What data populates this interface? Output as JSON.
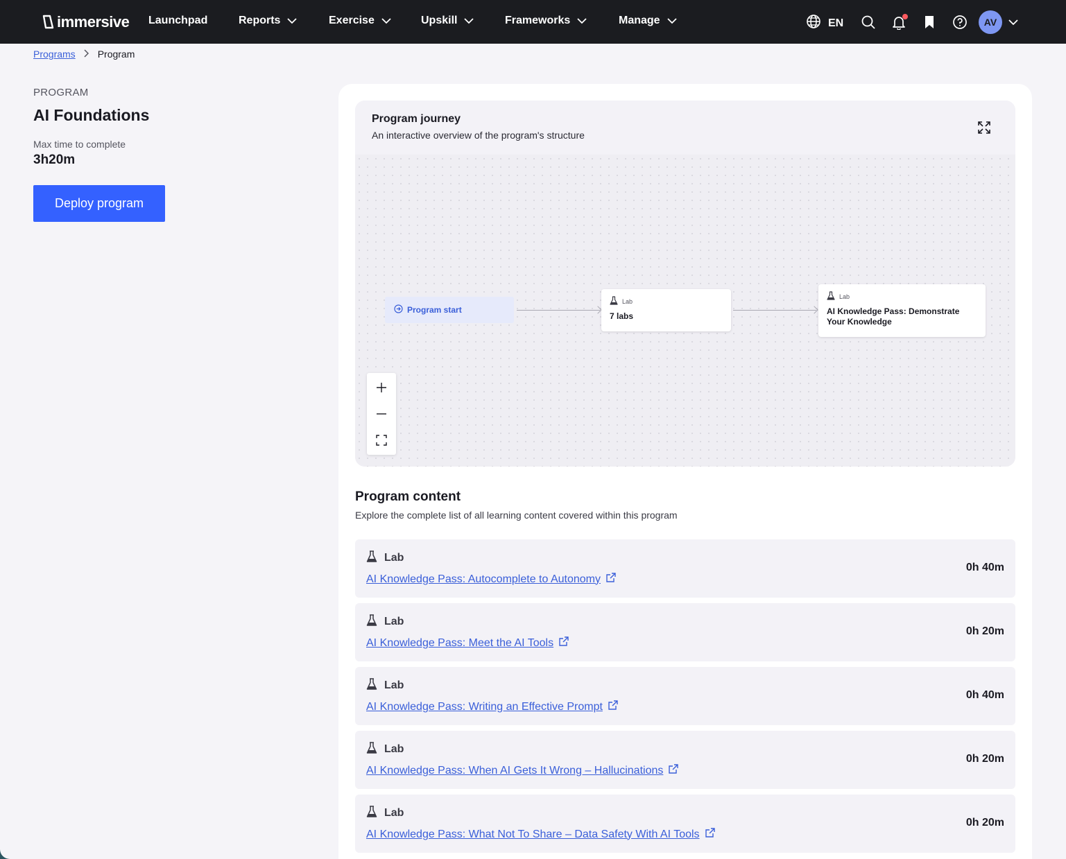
{
  "nav": {
    "brand": "immersive",
    "items": [
      {
        "label": "Launchpad",
        "dropdown": false
      },
      {
        "label": "Reports",
        "dropdown": true
      },
      {
        "label": "Exercise",
        "dropdown": true
      },
      {
        "label": "Upskill",
        "dropdown": true
      },
      {
        "label": "Frameworks",
        "dropdown": true
      },
      {
        "label": "Manage",
        "dropdown": true
      }
    ],
    "language": "EN",
    "avatar_initials": "AV",
    "icons": [
      "globe-icon",
      "search-icon",
      "bell-icon",
      "bookmark-icon",
      "help-icon",
      "chevron-down-icon"
    ]
  },
  "breadcrumb": {
    "parent": "Programs",
    "current": "Program"
  },
  "program": {
    "eyebrow": "PROGRAM",
    "title": "AI Foundations",
    "max_time_label": "Max time to complete",
    "max_time_value": "3h20m",
    "deploy_label": "Deploy program"
  },
  "journey": {
    "title": "Program journey",
    "subtitle": "An interactive overview of the program's structure",
    "start_label": "Program start",
    "nodes": [
      {
        "type": "Lab",
        "title": "7 labs"
      },
      {
        "type": "Lab",
        "title": "AI Knowledge Pass: Demonstrate Your Knowledge"
      }
    ]
  },
  "content": {
    "title": "Program content",
    "subtitle": "Explore the complete list of all learning content covered within this program",
    "items": [
      {
        "type": "Lab",
        "title": "AI Knowledge Pass: Autocomplete to Autonomy",
        "duration": "0h 40m"
      },
      {
        "type": "Lab",
        "title": "AI Knowledge Pass: Meet the AI Tools",
        "duration": "0h 20m"
      },
      {
        "type": "Lab",
        "title": "AI Knowledge Pass: Writing an Effective Prompt",
        "duration": "0h 40m"
      },
      {
        "type": "Lab",
        "title": "AI Knowledge Pass: When AI Gets It Wrong – Hallucinations",
        "duration": "0h 20m"
      },
      {
        "type": "Lab",
        "title": "AI Knowledge Pass: What Not To Share – Data Safety With AI Tools",
        "duration": "0h 20m"
      }
    ]
  },
  "colors": {
    "nav_bg": "#1b1c20",
    "accent": "#3461ff",
    "link": "#3a5fd9",
    "page_bg": "#f5f4f8",
    "notification": "#ff5a5f"
  }
}
